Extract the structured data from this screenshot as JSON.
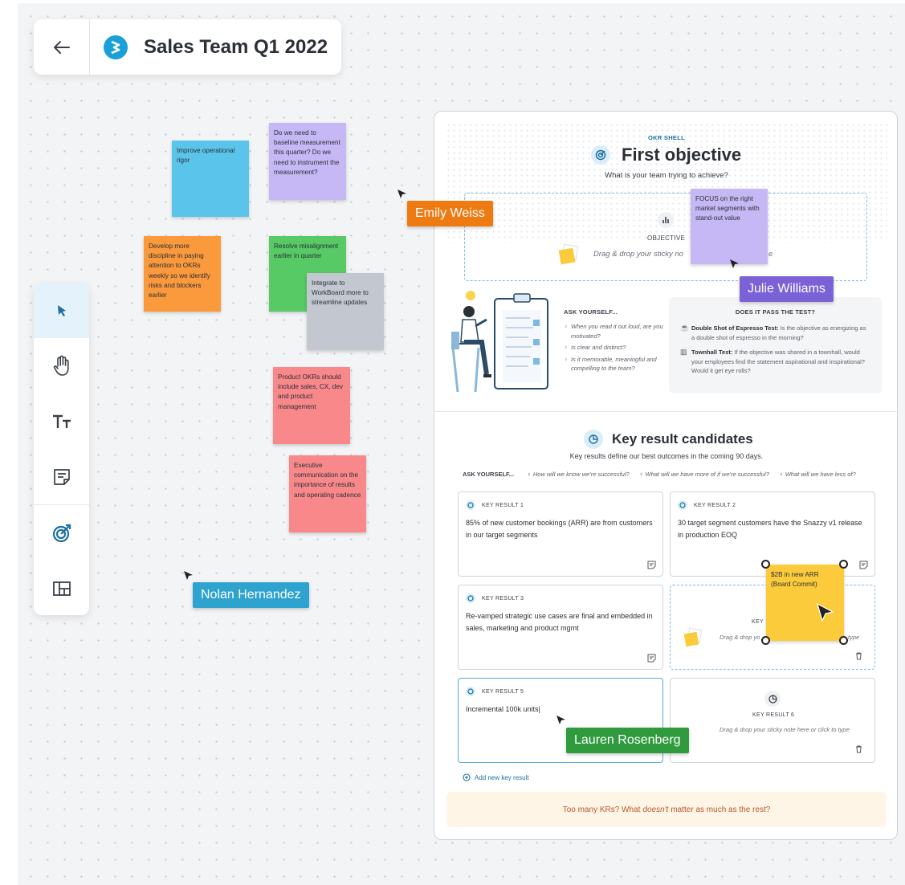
{
  "board": {
    "title": "Sales Team Q1 2022",
    "back_icon": "arrow-left-icon",
    "logo_icon": "workboard-logo-icon"
  },
  "toolbar": {
    "tools": [
      {
        "name": "select",
        "icon": "pointer-icon"
      },
      {
        "name": "hand",
        "icon": "hand-icon"
      },
      {
        "name": "text",
        "icon": "text-icon"
      },
      {
        "name": "sticky",
        "icon": "sticky-note-icon"
      },
      {
        "name": "okr",
        "icon": "target-icon"
      },
      {
        "name": "template",
        "icon": "layout-icon"
      }
    ]
  },
  "stickies": [
    {
      "text": "Improve operational rigor",
      "color": "#5bc4ea"
    },
    {
      "text": "Do we need to baseline measurement this quarter? Do we need to instrument the measurement?",
      "color": "#c6b8f5"
    },
    {
      "text": "Develop more discipline in paying attention to OKRs weekly so we identify risks and blockers earlier",
      "color": "#fb9a3c"
    },
    {
      "text": "Resolve misalignment earlier in quarter",
      "color": "#57c965"
    },
    {
      "text": "Integrate to WorkBoard more to streamline updates",
      "color": "#c3c7cf"
    },
    {
      "text": "Product OKRs should include sales, CX, dev and product management",
      "color": "#f8888a"
    },
    {
      "text": "Executive communication on the importance of results and operating cadence",
      "color": "#f8888a"
    },
    {
      "text": "FOCUS on the right market segments with stand-out value",
      "color": "#c6b8f5"
    },
    {
      "text": "$2B in new ARR (Board Commit)",
      "color": "#fccb3c"
    }
  ],
  "collaborators": [
    {
      "name": "Emily Weiss",
      "color": "#ee7a12"
    },
    {
      "name": "Julie Williams",
      "color": "#7b61d6"
    },
    {
      "name": "Nolan Hernandez",
      "color": "#2ea3cf"
    },
    {
      "name": "Lauren Rosenberg",
      "color": "#2f9a3e"
    }
  ],
  "okr": {
    "shell_label": "OKR SHELL",
    "title": "First objective",
    "subtitle": "What is your team trying to achieve?",
    "objective_label": "OBJECTIVE",
    "objective_drop_left": "Drag & drop your sticky no",
    "objective_drop_right": "e",
    "ask_heading": "ASK YOURSELF...",
    "ask_items": [
      "When you read it out loud, are you motivated?",
      "Is clear and distinct?",
      "Is it memorable, meaningful and compelling to the team?"
    ],
    "test_heading": "DOES IT PASS THE TEST?",
    "tests": [
      {
        "name": "Double Shot of Espresso Test:",
        "text": "Is the objective as energizing as a double shot of espresso in the morning?"
      },
      {
        "name": "Townhall Test:",
        "text": "If the objective was shared in a townhall, would your employees find the statement aspirational and inspirational? Would it get eye rolls?"
      }
    ]
  },
  "key_results": {
    "title": "Key result candidates",
    "subtitle": "Key results define our best outcomes in the coming 90 days.",
    "ask_label": "ASK YOURSELF...",
    "ask_questions": [
      "How will we know we're successful?",
      "What will we have more of if we're successful?",
      "What will we have less of?"
    ],
    "cards": [
      {
        "label": "KEY RESULT 1",
        "text": "85% of new customer bookings (ARR) are from customers in our target segments"
      },
      {
        "label": "KEY RESULT 2",
        "text": "30 target segment customers have the Snazzy v1 release in production EOQ"
      },
      {
        "label": "KEY RESULT 3",
        "text": "Re-vamped strategic use cases are final and embedded in sales, marketing and product mgmt"
      },
      {
        "label": "KEY",
        "drop_left": "Drag & drop yo",
        "drop_right": "type"
      },
      {
        "label": "KEY RESULT 5",
        "text": "Incremental 100k units|"
      },
      {
        "label": "KEY RESULT 6",
        "drop_text": "Drag & drop your sticky note here or click to type"
      }
    ],
    "add_label": "Add new key result",
    "banner_pre": "Too many KRs?  What",
    "banner_em": "doesn't",
    "banner_post": "matter as much as the rest?"
  }
}
